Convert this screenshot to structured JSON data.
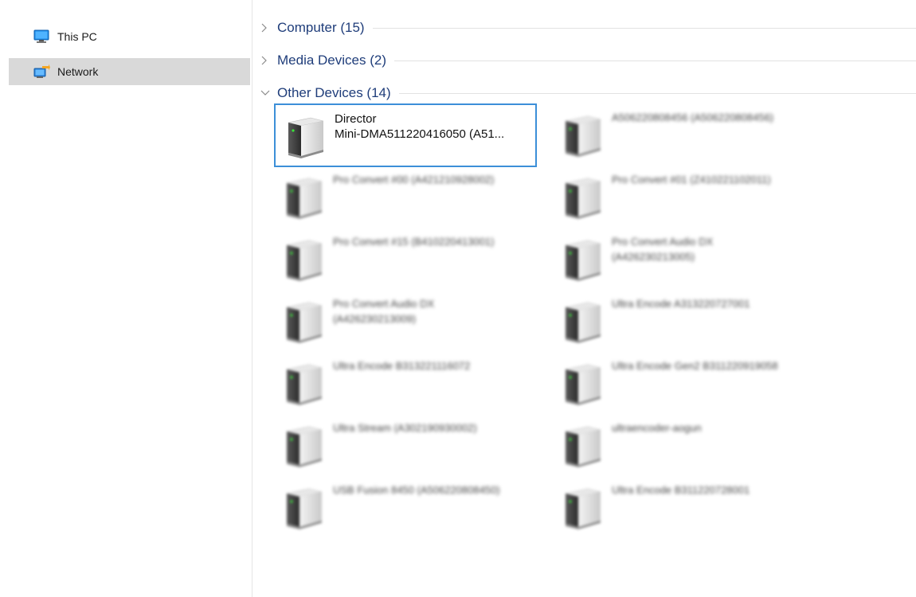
{
  "navigation": {
    "items": [
      {
        "label": "This PC",
        "icon": "monitor-icon",
        "selected": false
      },
      {
        "label": "Network",
        "icon": "network-icon",
        "selected": true
      }
    ]
  },
  "groups": [
    {
      "title": "Computer (15)",
      "expanded": false
    },
    {
      "title": "Media Devices (2)",
      "expanded": false
    },
    {
      "title": "Other Devices (14)",
      "expanded": true
    }
  ],
  "devices": [
    {
      "line1": "Director",
      "line2": "Mini-DMA511220416050 (A51...",
      "selected": true,
      "blurred": false
    },
    {
      "line1": "A506220808456 (A506220808456)",
      "line2": "",
      "selected": false,
      "blurred": true
    },
    {
      "line1": "Pro Convert #00 (A421210928002)",
      "line2": "",
      "selected": false,
      "blurred": true
    },
    {
      "line1": "Pro Convert #01 (Z410221102011)",
      "line2": "",
      "selected": false,
      "blurred": true
    },
    {
      "line1": "Pro Convert #15 (B410220413001)",
      "line2": "",
      "selected": false,
      "blurred": true
    },
    {
      "line1": "Pro Convert Audio DX",
      "line2": "(A426230213005)",
      "selected": false,
      "blurred": true
    },
    {
      "line1": "Pro Convert Audio DX",
      "line2": "(A426230213009)",
      "selected": false,
      "blurred": true
    },
    {
      "line1": "Ultra Encode A313220727001",
      "line2": "",
      "selected": false,
      "blurred": true
    },
    {
      "line1": "Ultra Encode B313221116072",
      "line2": "",
      "selected": false,
      "blurred": true
    },
    {
      "line1": "Ultra Encode Gen2 B311220919058",
      "line2": "",
      "selected": false,
      "blurred": true
    },
    {
      "line1": "Ultra Stream (A302190930002)",
      "line2": "",
      "selected": false,
      "blurred": true
    },
    {
      "line1": "ultraencoder-aogun",
      "line2": "",
      "selected": false,
      "blurred": true
    },
    {
      "line1": "USB Fusion 8450 (A506220808450)",
      "line2": "",
      "selected": false,
      "blurred": true
    },
    {
      "line1": "Ultra Encode B311220728001",
      "line2": "",
      "selected": false,
      "blurred": true
    }
  ],
  "colors": {
    "selection_border": "#3c8fd8",
    "nav_selected_bg": "#d9d9d9",
    "group_title": "#1f3d7a"
  }
}
